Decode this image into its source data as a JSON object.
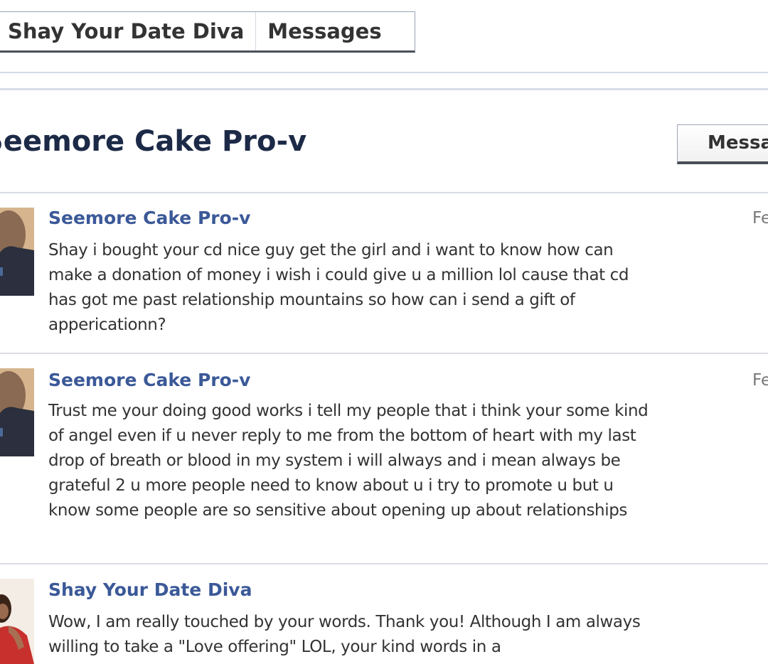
{
  "breadcrumb": {
    "items": [
      {
        "label": "Shay Your Date Diva"
      },
      {
        "label": "Messages"
      }
    ]
  },
  "thread": {
    "title": "Seemore Cake Pro-v",
    "message_button": "Messa"
  },
  "messages": [
    {
      "author": "Seemore Cake Pro-v",
      "date": "Fe",
      "body": "Shay i bought your cd nice guy get the girl and i want to know how can make a donation of money i wish i could give u a million lol cause that cd has got me past relationship mountains so how can i send a gift of appericationn?"
    },
    {
      "author": "Seemore Cake Pro-v",
      "date": "Fe",
      "body": "Trust me your doing good works i tell my people that i think your some kind of angel even if u never reply to me from the bottom of heart with my last drop of breath or blood in my system i will always and i mean always be grateful 2 u more people need to know about u i try to promote u but u know some people are so sensitive about opening up about relationships"
    },
    {
      "author": "Shay Your Date Diva",
      "date": "",
      "body": "Wow, I am really touched by your words. Thank you! Although I am always willing to take a \"Love offering\" LOL, your kind words in a"
    }
  ],
  "colors": {
    "link_blue": "#3b5998",
    "title_navy": "#1c2a47",
    "text": "#333333"
  }
}
